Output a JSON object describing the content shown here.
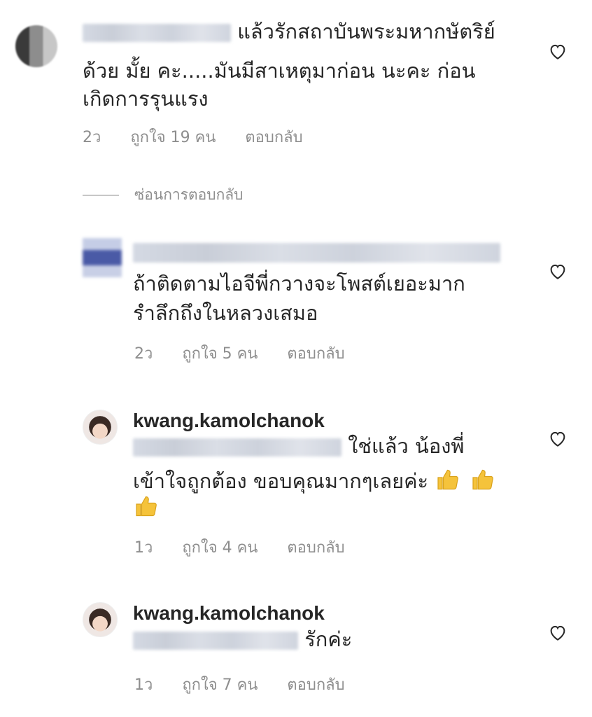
{
  "comments": [
    {
      "text_lines": [
        "แล้วรักสถาบันพระมหากษัตริย์",
        "ด้วย มั้ย คะ.....มันมีสาเหตุมาก่อน นะคะ ก่อน",
        "เกิดการรุนแรง"
      ],
      "time": "2ว",
      "likes": "ถูกใจ 19 คน",
      "reply": "ตอบกลับ"
    },
    {
      "text_lines": [
        "ถ้าติดตามไอจีพี่กวางจะโพสต์เยอะมาก",
        "รำลึกถึงในหลวงเสมอ"
      ],
      "time": "2ว",
      "likes": "ถูกใจ 5 คน",
      "reply": "ตอบกลับ"
    },
    {
      "username": "kwang.kamolchanok",
      "text_lines": [
        "ใช่แล้ว น้องพี่",
        "เข้าใจถูกต้อง ขอบคุณมากๆเลยค่ะ"
      ],
      "emoji": "thumbs-up",
      "time": "1ว",
      "likes": "ถูกใจ 4 คน",
      "reply": "ตอบกลับ"
    },
    {
      "username": "kwang.kamolchanok",
      "text_lines": [
        "รักค่ะ"
      ],
      "time": "1ว",
      "likes": "ถูกใจ 7 คน",
      "reply": "ตอบกลับ"
    }
  ],
  "hide_replies": "ซ่อนการตอบกลับ",
  "icons": {
    "like": "heart-outline-icon",
    "reaction": "thumbs-up-emoji"
  },
  "colors": {
    "text": "#262626",
    "meta": "#8e8e8e",
    "emoji": "#f5c33b"
  }
}
